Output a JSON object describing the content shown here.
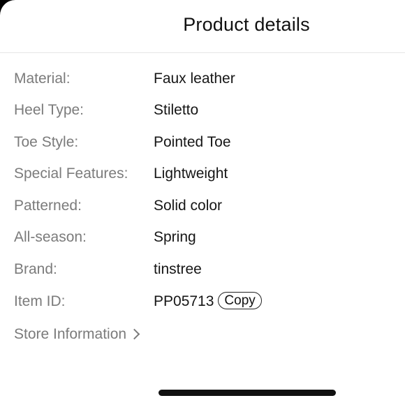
{
  "header": {
    "title": "Product details"
  },
  "details": [
    {
      "label": "Material:",
      "value": "Faux leather"
    },
    {
      "label": "Heel Type:",
      "value": "Stiletto"
    },
    {
      "label": "Toe Style:",
      "value": "Pointed Toe"
    },
    {
      "label": "Special Features:",
      "value": "Lightweight"
    },
    {
      "label": "Patterned:",
      "value": "Solid color"
    },
    {
      "label": "All-season:",
      "value": "Spring"
    },
    {
      "label": "Brand:",
      "value": "tinstree"
    },
    {
      "label": "Item ID:",
      "value": "PP05713"
    }
  ],
  "copy_label": "Copy",
  "store_link": {
    "label": "Store Information",
    "icon": "chevron-right-icon"
  },
  "colors": {
    "label": "#7b7b7b",
    "value": "#161616",
    "background": "#ffffff",
    "divider": "#e6e6e6"
  }
}
